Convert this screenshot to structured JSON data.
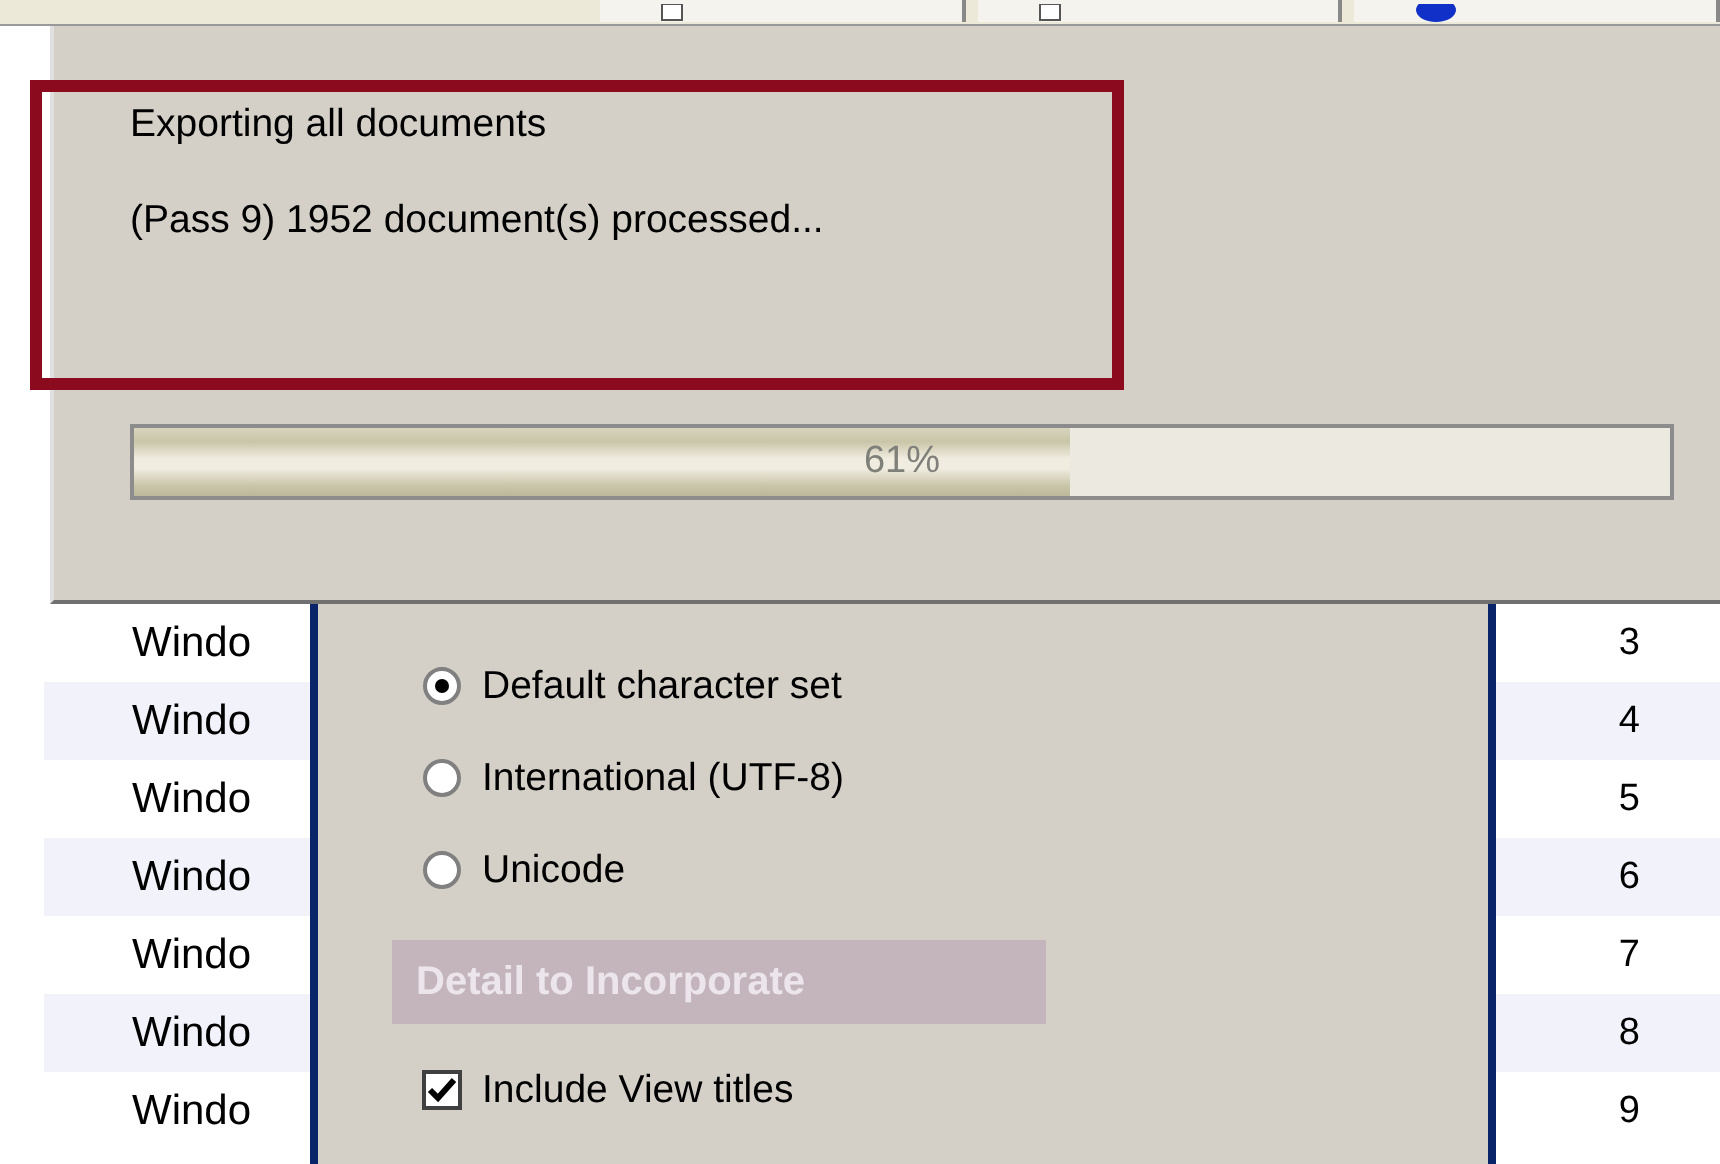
{
  "tab_strip": {
    "tabs": [
      {
        "kind": "page"
      },
      {
        "kind": "page"
      },
      {
        "kind": "globe"
      }
    ]
  },
  "progress_dialog": {
    "title": "Exporting all documents",
    "status": "(Pass 9) 1952 document(s) processed...",
    "progress": {
      "level": 0.61,
      "reading": "61%"
    }
  },
  "list": {
    "rows": [
      {
        "name": "Windo",
        "number": "3"
      },
      {
        "name": "Windo",
        "number": "4"
      },
      {
        "name": "Windo",
        "number": "5"
      },
      {
        "name": "Windo",
        "number": "6"
      },
      {
        "name": "Windo",
        "number": "7"
      },
      {
        "name": "Windo",
        "number": "8"
      },
      {
        "name": "Windo",
        "number": "9"
      }
    ]
  },
  "export_options": {
    "character_sets": [
      {
        "label": "Default character set",
        "selected": true
      },
      {
        "label": "International (UTF-8)",
        "selected": false
      },
      {
        "label": "Unicode",
        "selected": false
      }
    ],
    "detail_heading": "Detail to Incorporate",
    "checkboxes": [
      {
        "label": "Include View titles",
        "checked": true
      }
    ]
  }
}
